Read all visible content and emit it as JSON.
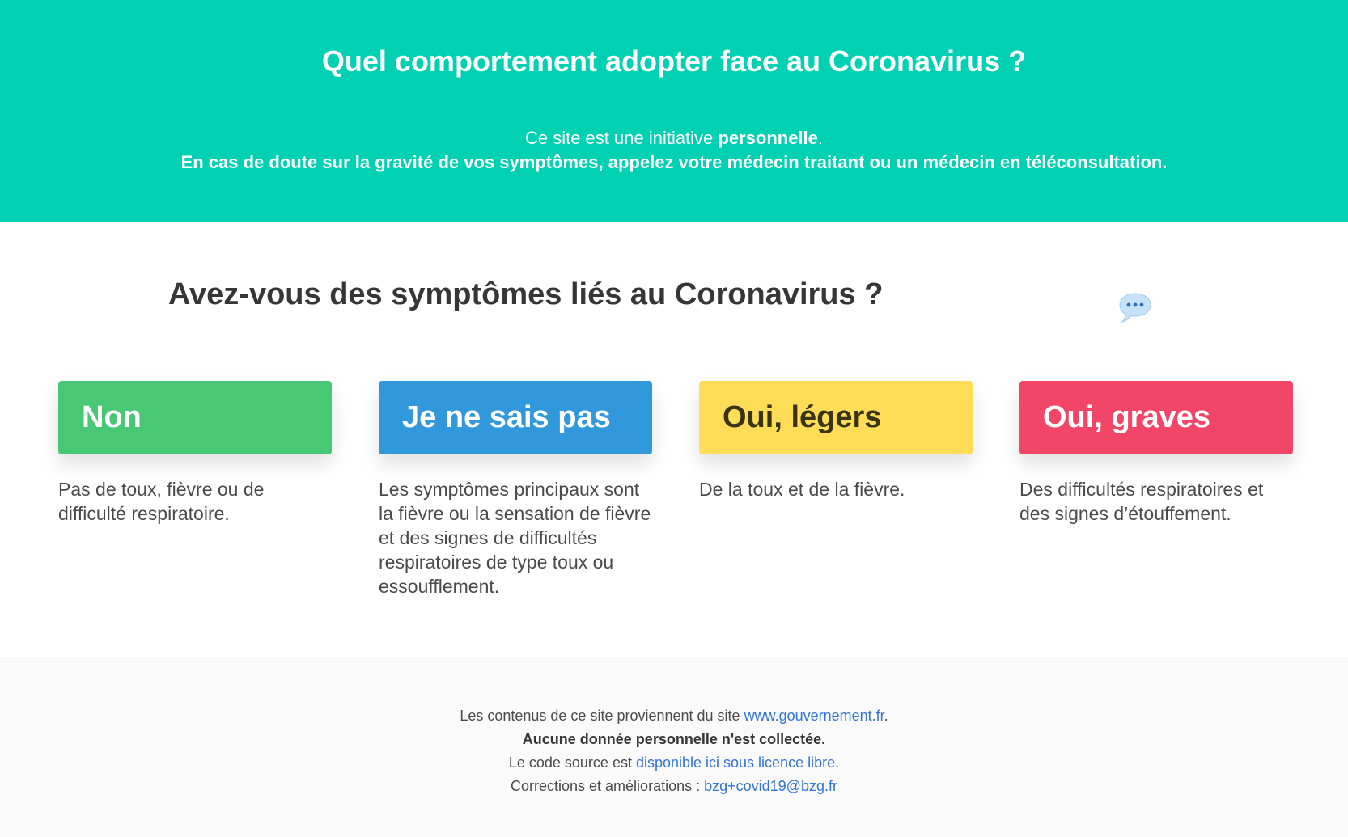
{
  "hero": {
    "title": "Quel comportement adopter face au Coronavirus ?",
    "line1_prefix": "Ce site est une initiative ",
    "line1_bold": "personnelle",
    "line1_suffix": ".",
    "line2": "En cas de doute sur la gravité de vos symptômes, appelez votre médecin traitant ou un médecin en téléconsultation."
  },
  "question": {
    "title": "Avez-vous des symptômes liés au Coronavirus ?",
    "icon": "speech-bubble-icon"
  },
  "options": [
    {
      "label": "Non",
      "description": "Pas de toux, fièvre ou de difficulté respiratoire.",
      "background": "#48c774",
      "text_color": "#ffffff"
    },
    {
      "label": "Je ne sais pas",
      "description": "Les symptômes principaux sont la fièvre ou la sensation de fièvre et des signes de difficultés respiratoires de type toux ou essoufflement.",
      "background": "#3298dc",
      "text_color": "#ffffff"
    },
    {
      "label": "Oui, légers",
      "description": "De la toux et de la fièvre.",
      "background": "#ffdd57",
      "text_color": "#3b3414"
    },
    {
      "label": "Oui, graves",
      "description": "Des difficultés respiratoires et des signes d’étouffement.",
      "background": "#f14668",
      "text_color": "#ffffff"
    }
  ],
  "footer": {
    "line1_prefix": "Les contenus de ce site proviennent du site ",
    "line1_link": "www.gouvernement.fr",
    "line1_suffix": ".",
    "line2": "Aucune donnée personnelle n'est collectée.",
    "line3_prefix": "Le code source est ",
    "line3_link": "disponible ici sous licence libre",
    "line3_suffix": ".",
    "line4_prefix": "Corrections et améliorations : ",
    "line4_link": "bzg+covid19@bzg.fr"
  }
}
